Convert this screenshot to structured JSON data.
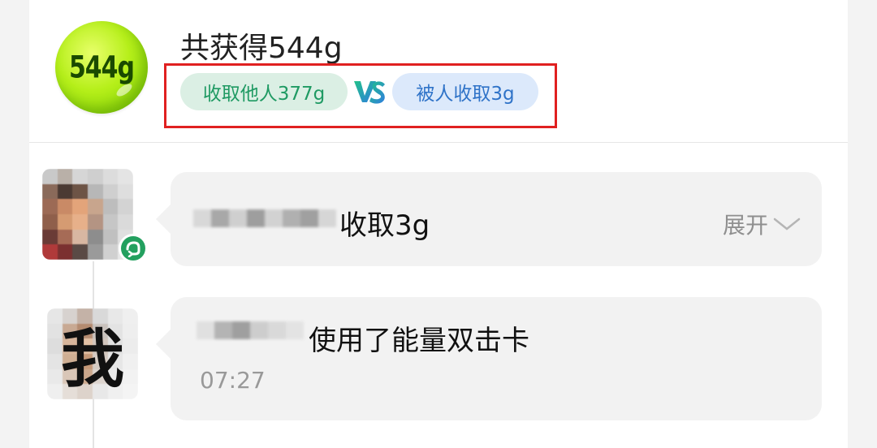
{
  "summary": {
    "energy_ball_label": "544g",
    "total_title": "共获得544g",
    "collected_from_others": "收取他人377g",
    "vs_label": "VS",
    "collected_by_others": "被人收取3g"
  },
  "records": [
    {
      "action_text": "收取3g",
      "expand_label": "展开"
    },
    {
      "avatar_text": "我",
      "action_text": "使用了能量双击卡",
      "time": "07:27"
    }
  ],
  "colors": {
    "green_pill_bg": "#dbefe4",
    "green_pill_text": "#1f9a63",
    "blue_pill_bg": "#dce9fb",
    "blue_pill_text": "#2f73c8",
    "highlight_border": "#e02020",
    "steal_badge": "#23a05f"
  }
}
